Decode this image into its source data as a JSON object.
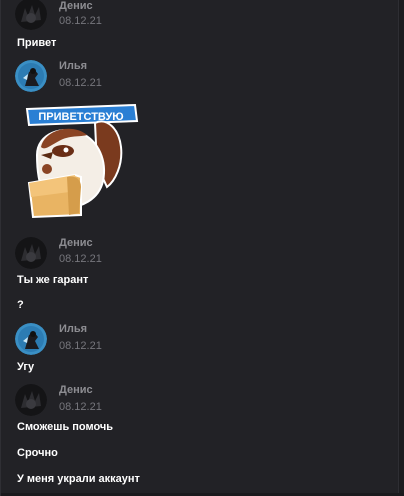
{
  "users": {
    "denis": {
      "name": "Денис",
      "avatar_icon": "dark-spiky-avatar-icon"
    },
    "ilya": {
      "name": "Илья",
      "avatar_icon": "blue-character-avatar-icon"
    }
  },
  "messages": [
    {
      "author": "Денис",
      "date": "08.12.21",
      "lines": [
        "Привет"
      ]
    },
    {
      "author": "Илья",
      "date": "08.12.21",
      "sticker": {
        "caption": "ПРИВЕТСТВУЮ",
        "icon": "sparrow-sticker-icon"
      }
    },
    {
      "author": "Денис",
      "date": "08.12.21",
      "lines": [
        "Ты же гарант",
        "?"
      ]
    },
    {
      "author": "Илья",
      "date": "08.12.21",
      "lines": [
        "Угу"
      ]
    },
    {
      "author": "Денис",
      "date": "08.12.21",
      "lines": [
        "Сможешь помочь",
        "Срочно",
        "У меня украли аккаунт"
      ]
    }
  ],
  "colors": {
    "background": "#222226",
    "name": "#8d8d92",
    "date": "#76767c",
    "text": "#ffffff"
  }
}
